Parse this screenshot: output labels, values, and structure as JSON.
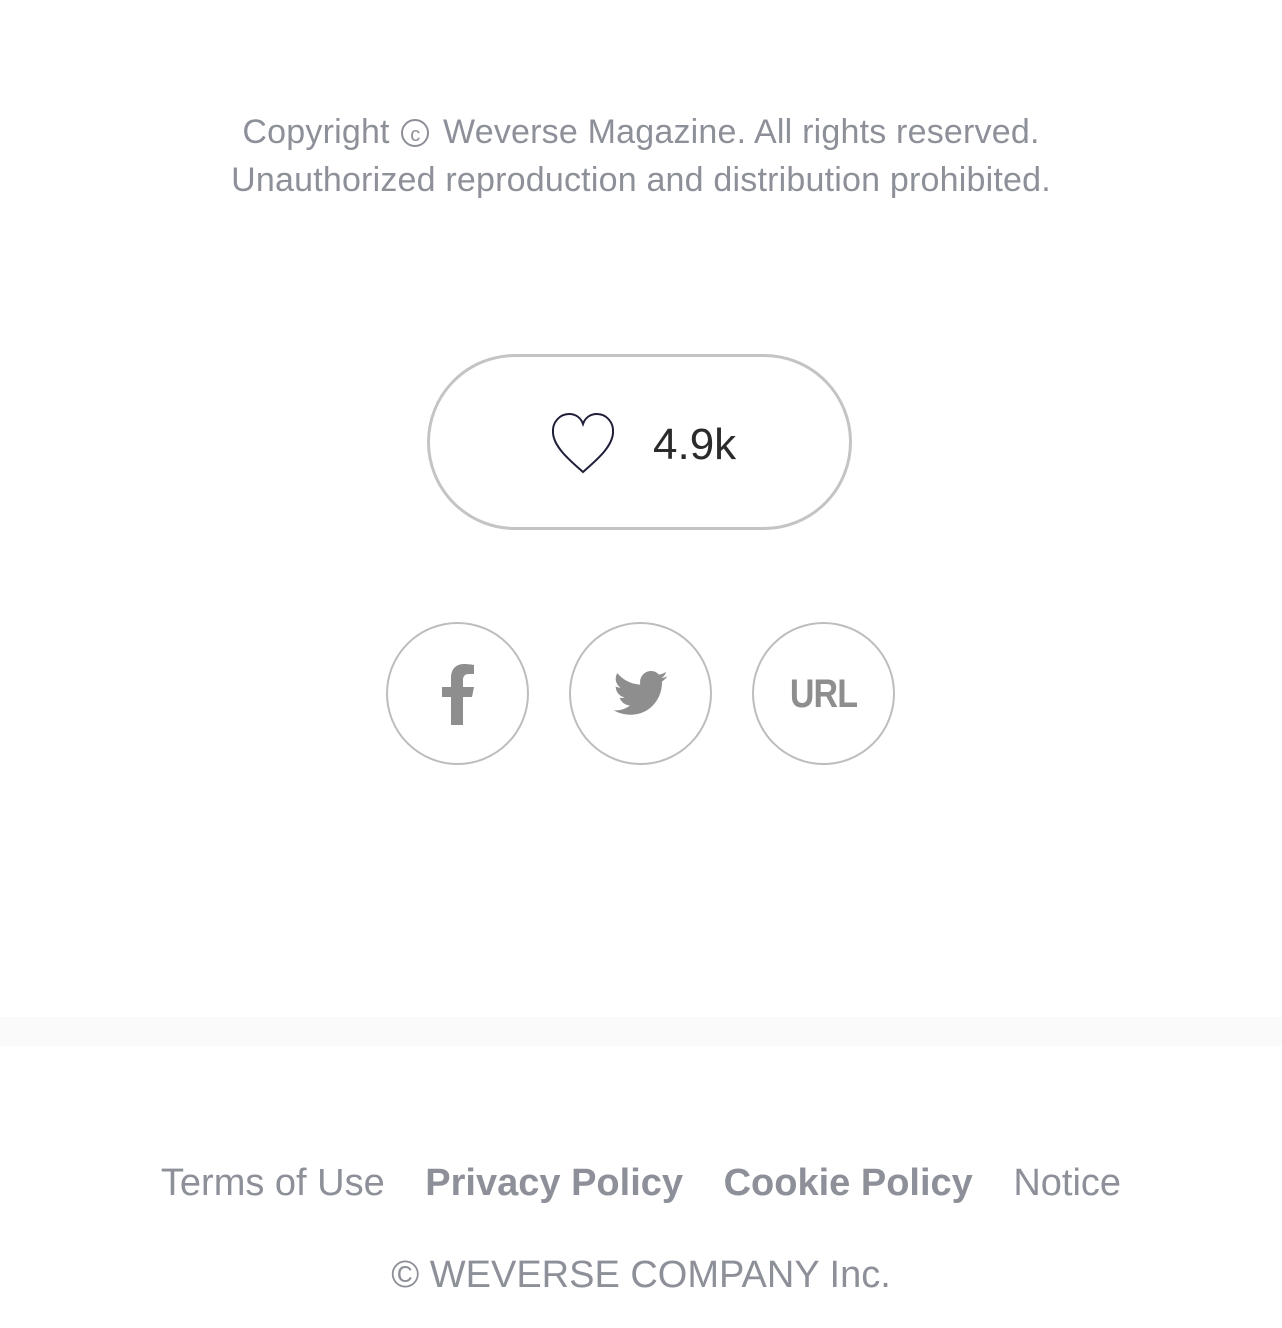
{
  "article": {
    "copyright_prefix": "Copyright",
    "copyright_symbol": "c",
    "copyright_suffix": "Weverse Magazine. All rights reserved.",
    "notice": "Unauthorized reproduction and distribution prohibited."
  },
  "like": {
    "icon": "heart-outline-icon",
    "count": "4.9k"
  },
  "share": {
    "facebook_icon": "facebook-icon",
    "twitter_icon": "twitter-icon",
    "url_label": "URL"
  },
  "footer": {
    "links": [
      {
        "label": "Terms of Use",
        "bold": false
      },
      {
        "label": "Privacy Policy",
        "bold": true
      },
      {
        "label": "Cookie Policy",
        "bold": true
      },
      {
        "label": "Notice",
        "bold": false
      }
    ],
    "company": "© WEVERSE COMPANY Inc."
  },
  "colors": {
    "muted_text": "#8e9099",
    "border": "#c4c4c4",
    "icon_gray": "#8e8e8e",
    "heart_stroke": "#1f1f3a",
    "count_text": "#2b2b2b",
    "divider_band": "#fafafa"
  }
}
